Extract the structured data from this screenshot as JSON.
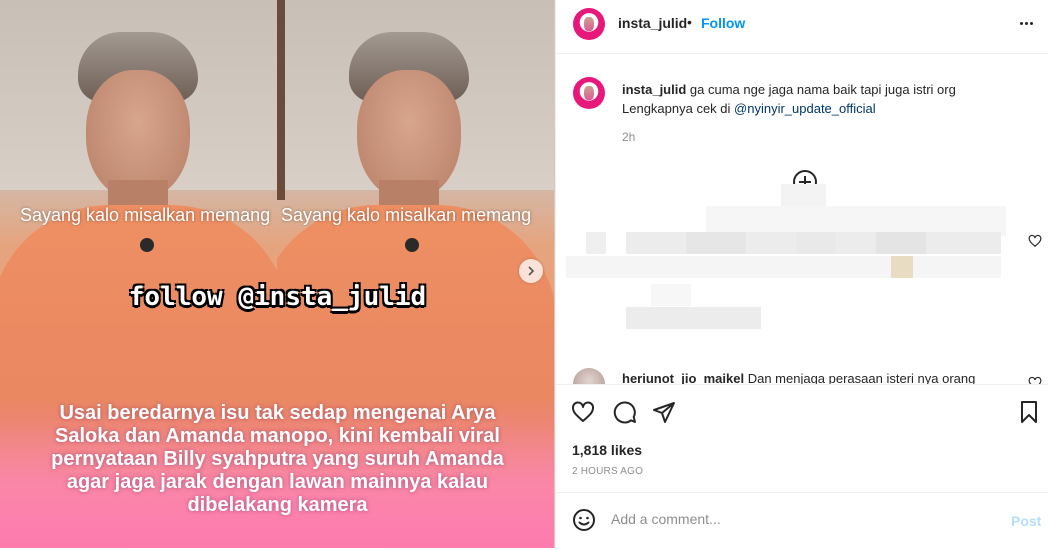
{
  "media": {
    "caption_top": "Sayang kalo misalkan memang",
    "watermark": "follow @insta_julid",
    "story_text": "Usai beredarnya isu tak sedap mengenai Arya Saloka dan Amanda manopo, kini kembali viral pernyataan Billy syahputra yang suruh Amanda agar jaga jarak dengan lawan mainnya kalau dibelakang kamera",
    "next_icon": "chevron-right-icon"
  },
  "header": {
    "username": "insta_julid",
    "separator": "•",
    "follow_label": "Follow",
    "more_icon": "more-options-icon"
  },
  "caption": {
    "username": "insta_julid",
    "text_line1": " ga cuma nge jaga nama baik tapi juga istri org",
    "text_line2_prefix": "Lengkapnya cek di ",
    "mention": "@nyinyir_update_official",
    "time": "2h"
  },
  "comment2": {
    "username": "heriunot_jio_maikel",
    "text": " Dan menjaga perasaan isteri nya orang"
  },
  "actions": {
    "likes": "1,818 likes",
    "ago": "2 HOURS AGO"
  },
  "add_comment": {
    "placeholder": "Add a comment...",
    "post_label": "Post"
  },
  "colors": {
    "accent": "#0095f6",
    "brand_pink": "#e8177a",
    "post_disabled": "#b2dffc"
  }
}
